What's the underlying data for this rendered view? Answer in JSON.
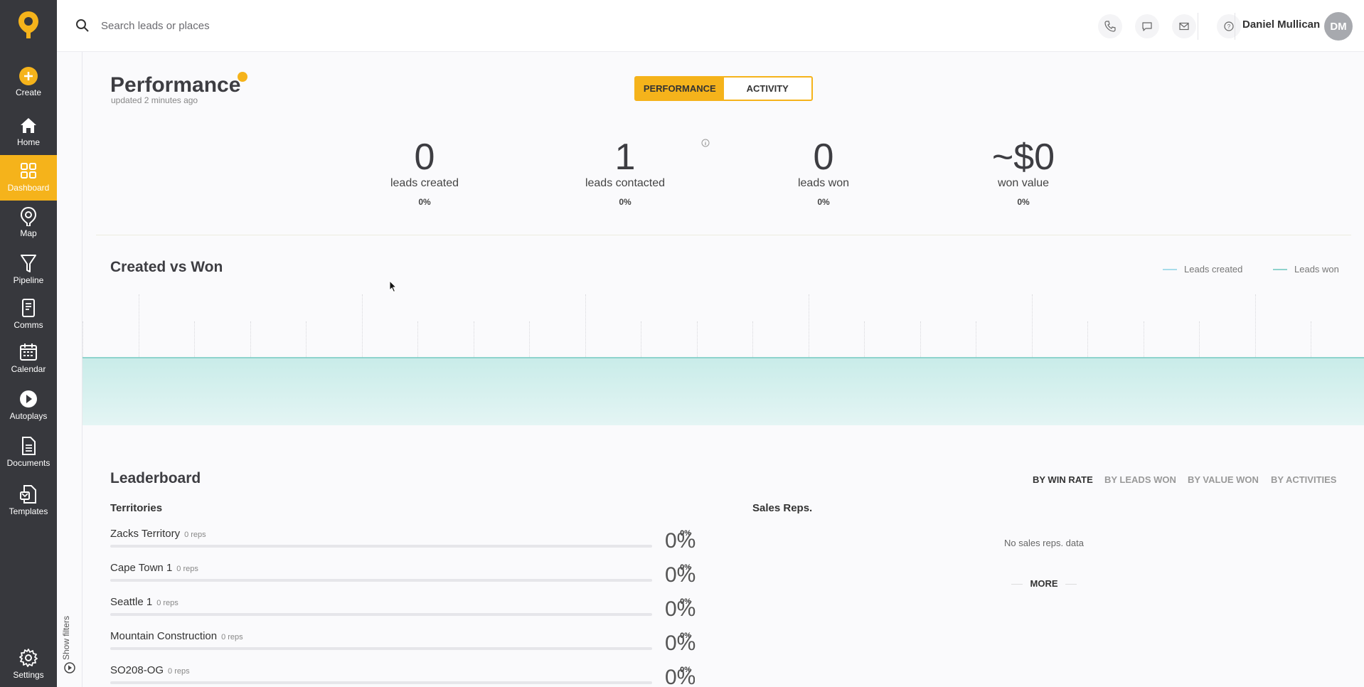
{
  "sidebar": {
    "items": [
      {
        "label": "Create",
        "icon": "plus-circle-icon"
      },
      {
        "label": "Home",
        "icon": "home-icon"
      },
      {
        "label": "Dashboard",
        "icon": "grid-icon"
      },
      {
        "label": "Map",
        "icon": "map-pin-icon"
      },
      {
        "label": "Pipeline",
        "icon": "funnel-icon"
      },
      {
        "label": "Comms",
        "icon": "comms-icon"
      },
      {
        "label": "Calendar",
        "icon": "calendar-icon"
      },
      {
        "label": "Autoplays",
        "icon": "play-circle-icon"
      },
      {
        "label": "Documents",
        "icon": "document-icon"
      },
      {
        "label": "Templates",
        "icon": "templates-icon"
      },
      {
        "label": "Settings",
        "icon": "gear-icon"
      }
    ],
    "active": "Dashboard"
  },
  "topbar": {
    "search_placeholder": "Search leads or places",
    "user_name": "Daniel Mullican",
    "user_initials": "DM"
  },
  "filters": {
    "label": "Show filters"
  },
  "header": {
    "title": "Performance",
    "updated": "updated 2 minutes ago",
    "toggle": {
      "performance": "PERFORMANCE",
      "activity": "ACTIVITY",
      "selected": "PERFORMANCE"
    }
  },
  "kpis": [
    {
      "value": "0",
      "label": "leads created",
      "pct": "0%"
    },
    {
      "value": "1",
      "label": "leads contacted",
      "pct": "0%"
    },
    {
      "value": "0",
      "label": "leads won",
      "pct": "0%"
    },
    {
      "value": "~$0",
      "label": "won value",
      "pct": "0%"
    }
  ],
  "chart": {
    "title": "Created vs Won",
    "legend": [
      {
        "name": "Leads created",
        "color": "#a8dcea"
      },
      {
        "name": "Leads won",
        "color": "#8fd3cd"
      }
    ]
  },
  "chart_data": {
    "type": "area",
    "title": "Created vs Won",
    "series": [
      {
        "name": "Leads created",
        "values": [
          0
        ]
      },
      {
        "name": "Leads won",
        "values": [
          0
        ]
      }
    ],
    "grid": true,
    "legend_position": "top-right"
  },
  "leaderboard": {
    "title": "Leaderboard",
    "tabs": [
      "BY WIN RATE",
      "BY LEADS WON",
      "BY VALUE WON",
      "BY ACTIVITIES"
    ],
    "active_tab": "BY WIN RATE",
    "territories_label": "Territories",
    "territories": [
      {
        "name": "Zacks Territory",
        "reps": "0 reps",
        "pct_small": "0%",
        "pct_large": "0%",
        "progress": 0
      },
      {
        "name": "Cape Town 1",
        "reps": "0 reps",
        "pct_small": "0%",
        "pct_large": "0%",
        "progress": 0
      },
      {
        "name": "Seattle 1",
        "reps": "0 reps",
        "pct_small": "0%",
        "pct_large": "0%",
        "progress": 0
      },
      {
        "name": "Mountain Construction",
        "reps": "0 reps",
        "pct_small": "0%",
        "pct_large": "0%",
        "progress": 0
      },
      {
        "name": "SO208-OG",
        "reps": "0 reps",
        "pct_small": "0%",
        "pct_large": "0%",
        "progress": 0
      }
    ],
    "sales_reps_label": "Sales Reps.",
    "no_data": "No sales reps. data",
    "more": "MORE"
  },
  "colors": {
    "accent": "#f5b31b",
    "sidebar": "#37383d",
    "chart_fill": "#c9ece9"
  }
}
